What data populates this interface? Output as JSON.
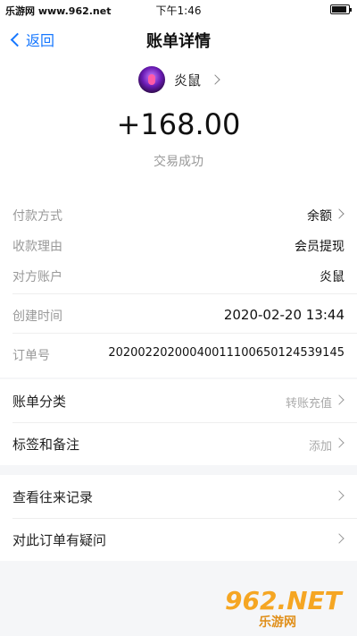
{
  "status_bar": {
    "carrier": "乐游网 www.962.net",
    "time": "下午1:46",
    "battery_level": 0.9
  },
  "nav": {
    "back_label": "返回",
    "title": "账单详情"
  },
  "summary": {
    "payee_name": "炎鼠",
    "amount": "+168.00",
    "status": "交易成功"
  },
  "details": [
    {
      "label": "付款方式",
      "value": "余额",
      "has_chevron": true
    },
    {
      "label": "收款理由",
      "value": "会员提现",
      "has_chevron": false
    },
    {
      "label": "对方账户",
      "value": "炎鼠",
      "has_chevron": false
    },
    {
      "label": "创建时间",
      "value": "2020-02-20 13:44",
      "has_chevron": false
    },
    {
      "label": "订单号",
      "value": "2020022020004001110065012453914​5",
      "has_chevron": false
    }
  ],
  "meta_section": [
    {
      "label": "账单分类",
      "value": "转账充值"
    },
    {
      "label": "标签和备注",
      "value": "添加"
    }
  ],
  "actions_section": [
    {
      "label": "查看往来记录"
    },
    {
      "label": "对此订单有疑问"
    }
  ],
  "watermark": {
    "main": "962.NET",
    "sub": "乐游网"
  },
  "colors": {
    "accent": "#1677ff",
    "background": "#f5f6f8"
  }
}
